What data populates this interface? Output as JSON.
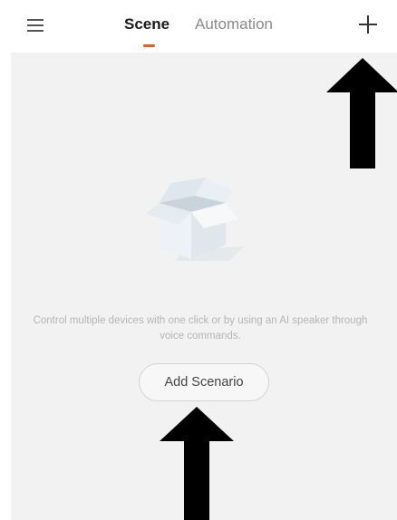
{
  "header": {
    "menu_icon": "hamburger-menu-icon",
    "tabs": [
      {
        "label": "Scene",
        "active": true
      },
      {
        "label": "Automation",
        "active": false
      }
    ],
    "add_icon": "plus-icon"
  },
  "empty_state": {
    "illustration": "open-box-illustration",
    "message": "Control multiple devices with one click or by using an AI speaker through voice commands.",
    "button_label": "Add Scenario"
  },
  "annotations": {
    "arrow_icon": "up-arrow-icon"
  },
  "colors": {
    "accent": "#f05a1a",
    "background": "#f2f2f2",
    "arrow": "#000000"
  }
}
